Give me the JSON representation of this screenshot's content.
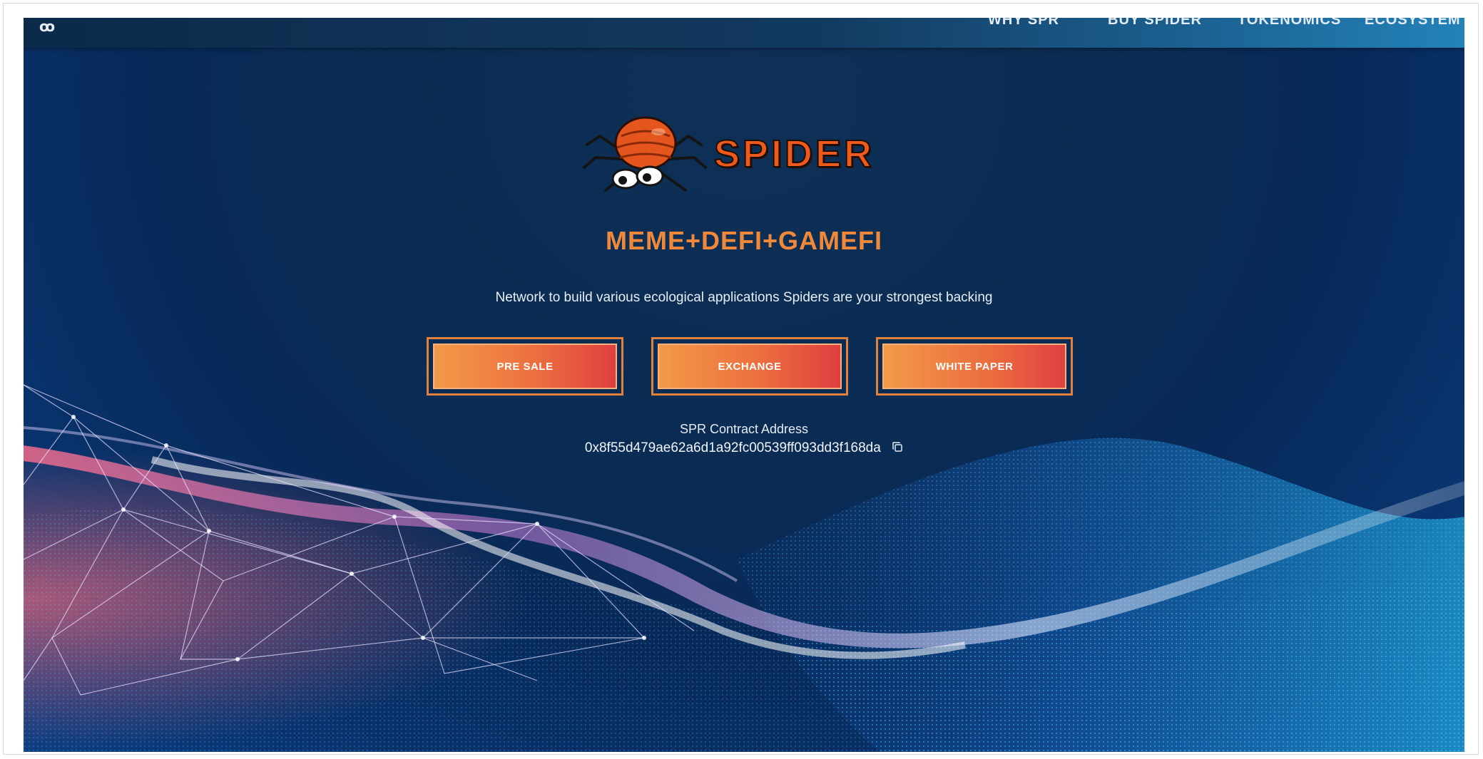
{
  "nav": {
    "brand_glyph": "ꝏ",
    "items": [
      {
        "label": "WHY SPR"
      },
      {
        "label": "BUY SPIDER"
      },
      {
        "label": "TOKENOMICS"
      },
      {
        "label": "ECOSYSTEM"
      }
    ]
  },
  "hero": {
    "logo_text": "SPIDER",
    "tagline": "MEME+DEFI+GAMEFI",
    "subtitle": "Network to build various ecological applications Spiders are your strongest backing",
    "buttons": [
      {
        "label": "PRE SALE"
      },
      {
        "label": "EXCHANGE"
      },
      {
        "label": "WHITE PAPER"
      }
    ],
    "contract": {
      "label": "SPR Contract Address",
      "address": "0x8f55d479ae62a6d1a92fc00539ff093dd3f168da",
      "copy_icon": "copy-icon"
    }
  },
  "colors": {
    "accent_orange": "#f0883a",
    "button_start": "#f39a49",
    "button_end": "#df3f40",
    "logo_orange": "#ef5a1c",
    "background_navy": "#0b2c52",
    "wave_cyan": "#2ad0ff"
  }
}
